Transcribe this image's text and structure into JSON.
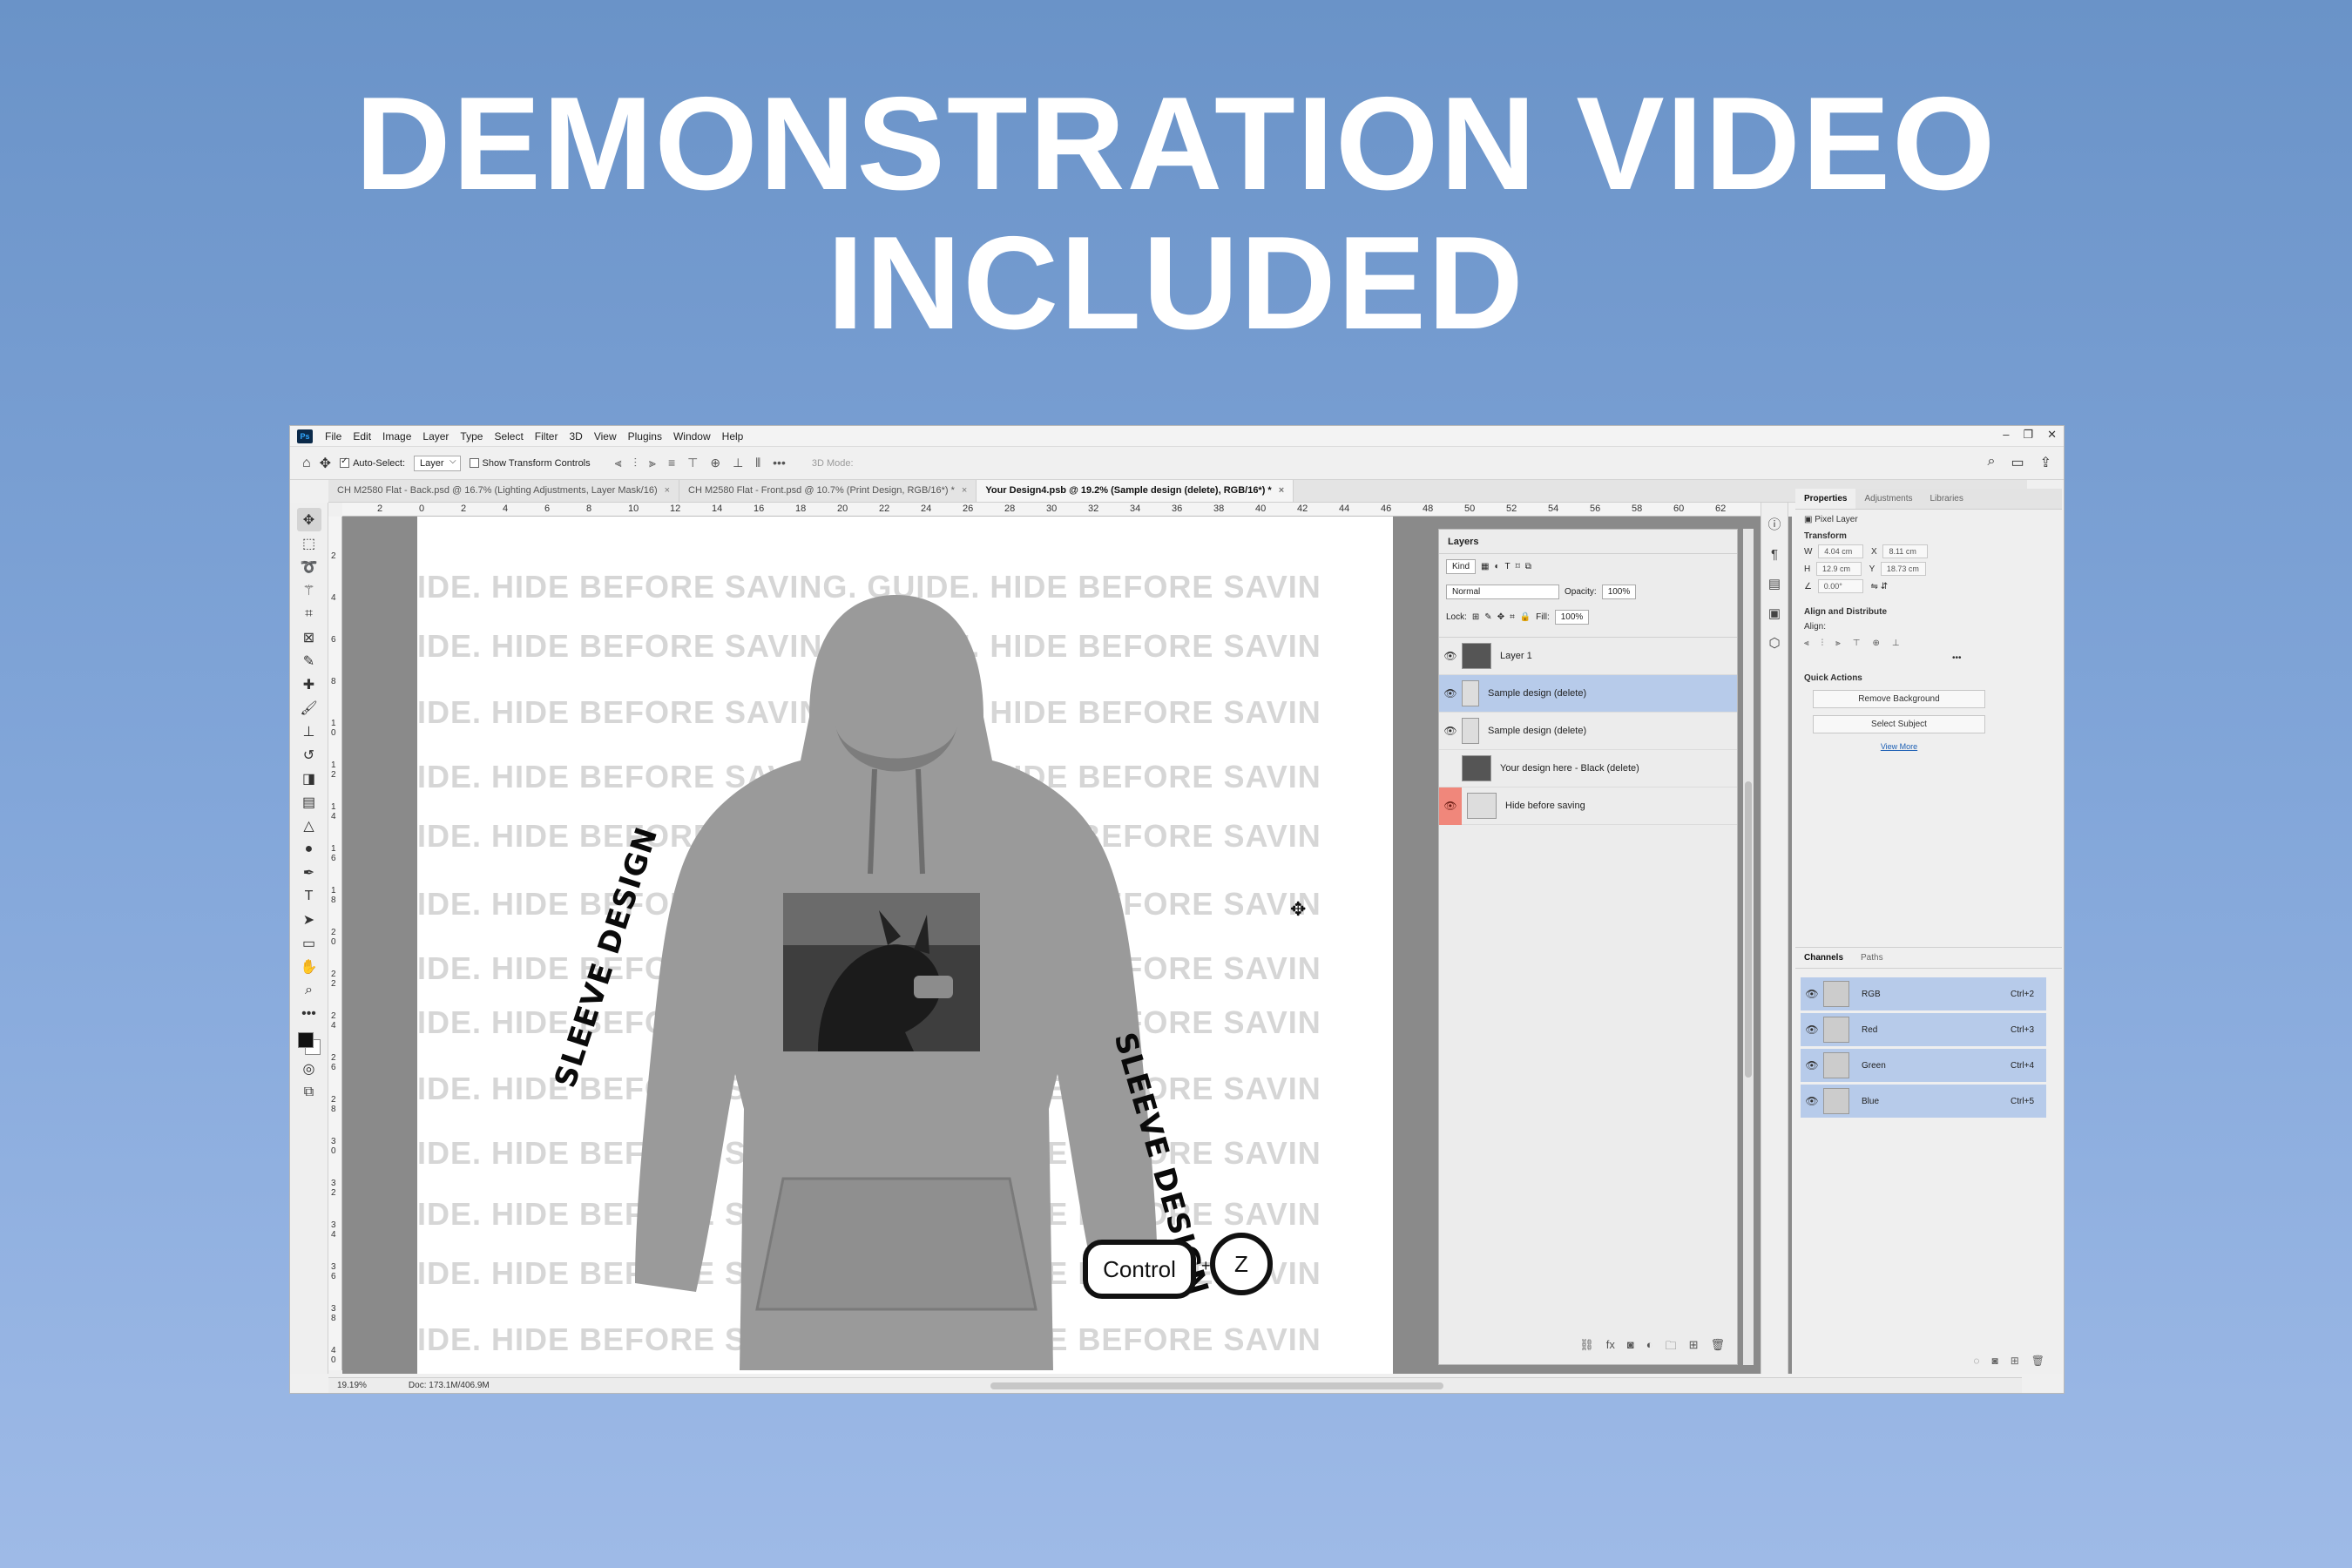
{
  "headline": {
    "line1": "DEMONSTRATION VIDEO",
    "line2": "INCLUDED"
  },
  "app": {
    "logo": "Ps",
    "menu": [
      "File",
      "Edit",
      "Image",
      "Layer",
      "Type",
      "Select",
      "Filter",
      "3D",
      "View",
      "Plugins",
      "Window",
      "Help"
    ]
  },
  "options_bar": {
    "auto_select_label": "Auto-Select:",
    "auto_select_value": "Layer",
    "show_transform_label": "Show Transform Controls",
    "mode_3d_label": "3D Mode:"
  },
  "tabs": [
    {
      "label": "CH M2580 Flat - Back.psd @ 16.7% (Lighting Adjustments, Layer Mask/16)",
      "active": false
    },
    {
      "label": "CH M2580 Flat - Front.psd @ 10.7% (Print Design, RGB/16*) *",
      "active": false
    },
    {
      "label": "Your Design4.psb @ 19.2% (Sample design (delete), RGB/16*) *",
      "active": true
    }
  ],
  "ruler": {
    "top": [
      "2",
      "0",
      "2",
      "4",
      "6",
      "8",
      "10",
      "12",
      "14",
      "16",
      "18",
      "20",
      "22",
      "24",
      "26",
      "28",
      "30",
      "32",
      "34",
      "36",
      "38",
      "40",
      "42",
      "44",
      "46",
      "48",
      "50",
      "52",
      "54",
      "56",
      "58",
      "60",
      "62"
    ],
    "left": [
      "2",
      "4",
      "6",
      "8",
      "1 0",
      "1 2",
      "1 4",
      "1 6",
      "1 8",
      "2 0",
      "2 2",
      "2 4",
      "2 6",
      "2 8",
      "3 0",
      "3 2",
      "3 4",
      "3 6",
      "3 8",
      "4 0"
    ]
  },
  "canvas": {
    "guide_text": "IDE. HIDE BEFORE SAVING. GUIDE. HIDE BEFORE SAVIN",
    "sleeve_text": "SLEEVE DESIGN",
    "key_control": "Control",
    "key_plus": "+",
    "key_z": "Z"
  },
  "layers": {
    "title": "Layers",
    "kind_label": "Kind",
    "blend_mode": "Normal",
    "opacity_label": "Opacity:",
    "opacity_value": "100%",
    "lock_label": "Lock:",
    "fill_label": "Fill:",
    "fill_value": "100%",
    "items": [
      {
        "name": "Layer 1",
        "visible": true,
        "selected": false
      },
      {
        "name": "Sample design (delete)",
        "visible": true,
        "selected": true
      },
      {
        "name": "Sample design (delete)",
        "visible": true,
        "selected": false
      },
      {
        "name": "Your design here - Black (delete)",
        "visible": false,
        "selected": false
      },
      {
        "name": "Hide before saving",
        "visible": true,
        "selected": false,
        "highlight": "#f0877b"
      }
    ]
  },
  "properties": {
    "tabs": [
      "Properties",
      "Adjustments",
      "Libraries"
    ],
    "pixel_layer": "Pixel Layer",
    "transform_head": "Transform",
    "w_label": "W",
    "w_value": "4.04 cm",
    "x_label": "X",
    "x_value": "8.11 cm",
    "h_label": "H",
    "h_value": "12.9 cm",
    "y_label": "Y",
    "y_value": "18.73 cm",
    "angle_value": "0.00°",
    "align_head": "Align and Distribute",
    "align_label": "Align:",
    "quick_head": "Quick Actions",
    "remove_bg": "Remove Background",
    "select_subject": "Select Subject",
    "view_more": "View More"
  },
  "channels": {
    "tabs": [
      "Channels",
      "Paths"
    ],
    "items": [
      {
        "name": "RGB",
        "shortcut": "Ctrl+2"
      },
      {
        "name": "Red",
        "shortcut": "Ctrl+3"
      },
      {
        "name": "Green",
        "shortcut": "Ctrl+4"
      },
      {
        "name": "Blue",
        "shortcut": "Ctrl+5"
      }
    ]
  },
  "status": {
    "zoom": "19.19%",
    "doc": "Doc: 173.1M/406.9M"
  }
}
